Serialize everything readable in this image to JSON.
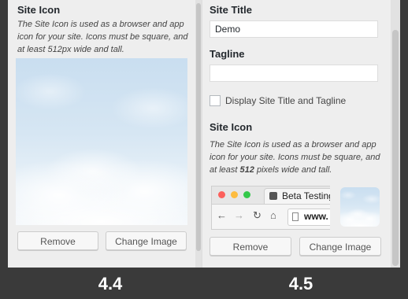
{
  "left_panel": {
    "heading": "Site Icon",
    "description": "The Site Icon is used as a browser and app icon for your site. Icons must be square, and at least 512px wide and tall.",
    "remove_label": "Remove",
    "change_label": "Change Image"
  },
  "right_panel": {
    "site_title_label": "Site Title",
    "site_title_value": "Demo",
    "tagline_label": "Tagline",
    "tagline_value": "",
    "display_checkbox_label": "Display Site Title and Tagline",
    "site_icon_heading": "Site Icon",
    "description_part1": "The Site Icon is used as a browser and app icon for your site. Icons must be square, and at least ",
    "description_bold": "512",
    "description_part2": " pixels wide and tall.",
    "browser_tab_title": "Beta Testing",
    "browser_url": "www.",
    "remove_label": "Remove",
    "change_label": "Change Image"
  },
  "footer": {
    "left_version": "4.4",
    "right_version": "4.5"
  },
  "icons": {
    "traffic_lights": [
      "red-dot-icon",
      "yellow-dot-icon",
      "green-dot-icon"
    ],
    "nav": [
      "back-arrow-icon",
      "forward-arrow-icon",
      "reload-icon",
      "home-icon"
    ]
  },
  "colors": {
    "footer_bg": "#3a3a3a",
    "panel_bg": "#eeeeee",
    "close_dot": "#fc605c",
    "minimize_dot": "#fdbc40",
    "zoom_dot": "#34c84a"
  }
}
